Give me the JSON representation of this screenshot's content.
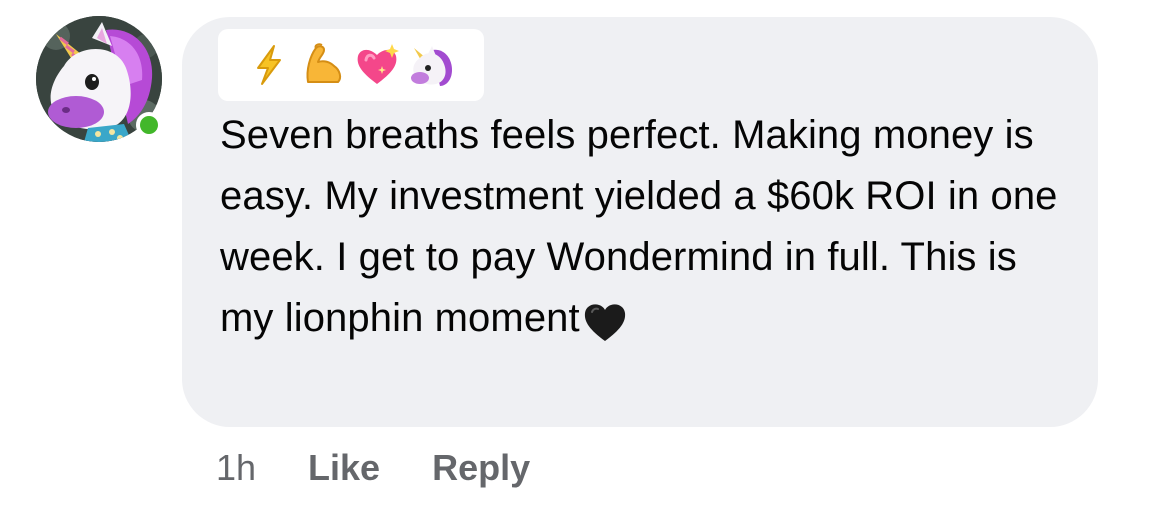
{
  "comment": {
    "avatar_icon": "unicorn-memoji-icon",
    "online_status_color": "#42b72a",
    "badges": [
      {
        "icon": "lightning-bolt-icon"
      },
      {
        "icon": "flexed-biceps-icon"
      },
      {
        "icon": "sparkling-heart-icon"
      },
      {
        "icon": "unicorn-icon"
      }
    ],
    "text": "Seven breaths feels perfect. Making money is easy. My investment yielded a $60k ROI in one week. I get to pay Wondermind in full. This is my lionphin moment",
    "trailing_icon": "black-heart-icon",
    "bubble_color": "#eff0f3"
  },
  "actions": {
    "timestamp": "1h",
    "like_label": "Like",
    "reply_label": "Reply"
  }
}
